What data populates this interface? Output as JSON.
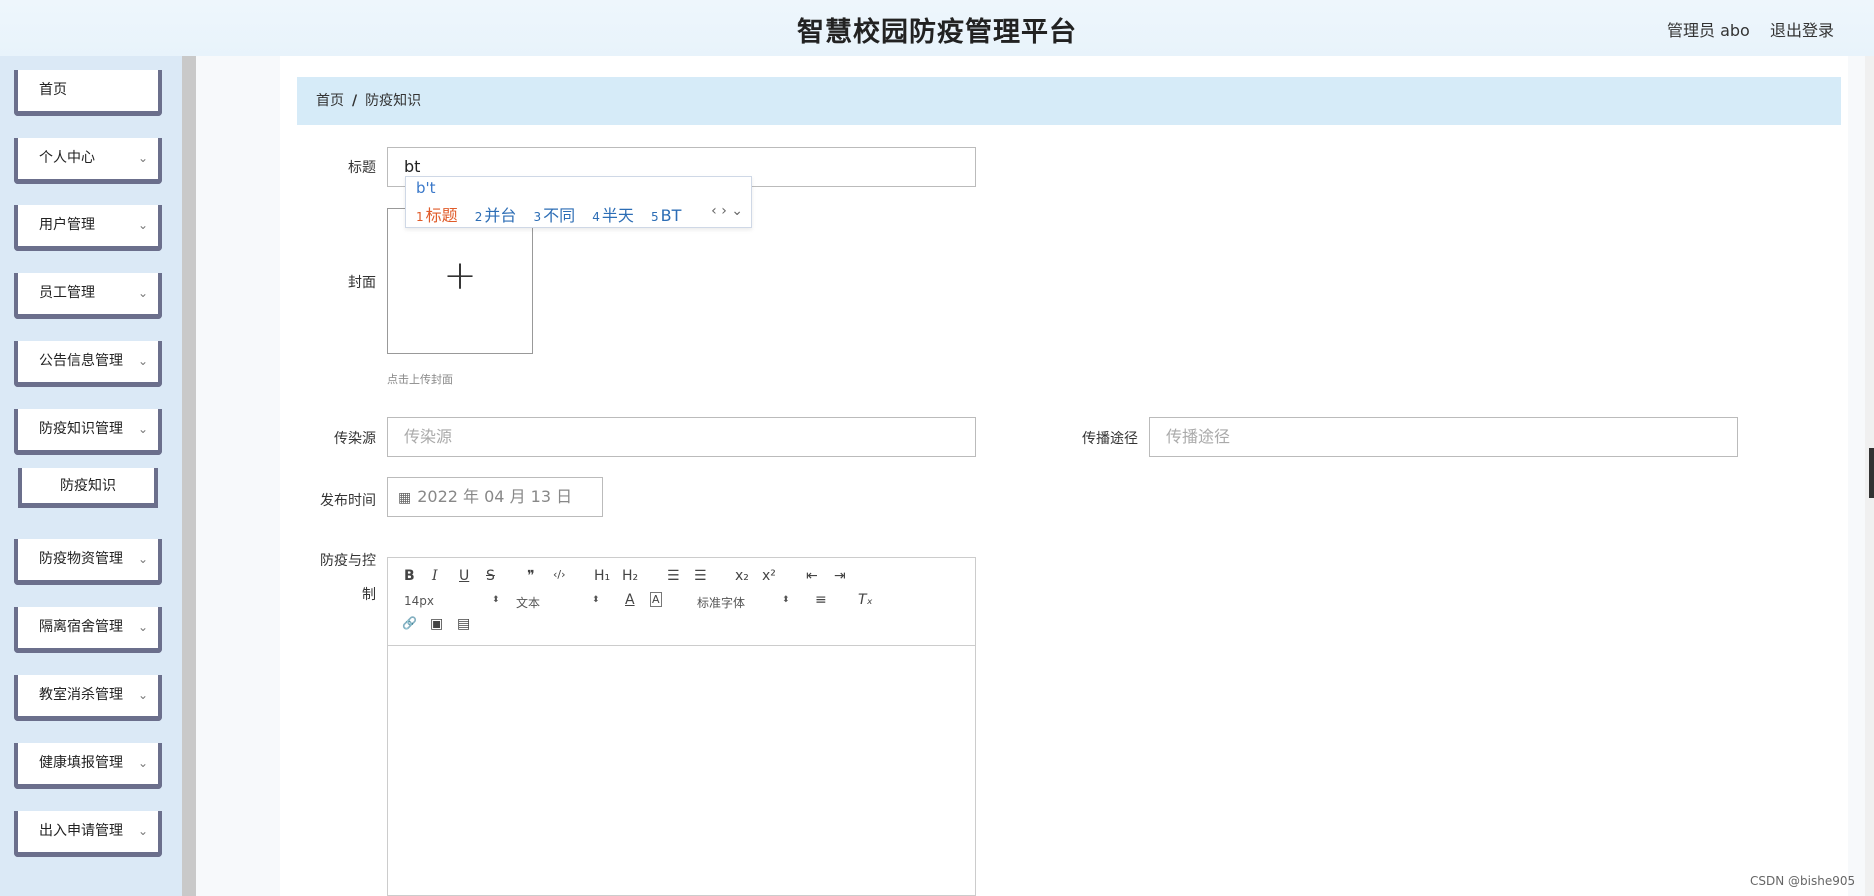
{
  "header": {
    "title": "智慧校园防疫管理平台",
    "user": "管理员 abo",
    "logout": "退出登录"
  },
  "sidebar": {
    "items": [
      {
        "label": "首页",
        "chevron": false
      },
      {
        "label": "个人中心",
        "chevron": true
      },
      {
        "label": "用户管理",
        "chevron": true
      },
      {
        "label": "员工管理",
        "chevron": true
      },
      {
        "label": "公告信息管理",
        "chevron": true
      },
      {
        "label": "防疫知识管理",
        "chevron": true
      },
      {
        "label": "防疫物资管理",
        "chevron": true
      },
      {
        "label": "隔离宿舍管理",
        "chevron": true
      },
      {
        "label": "教室消杀管理",
        "chevron": true
      },
      {
        "label": "健康填报管理",
        "chevron": true
      },
      {
        "label": "出入申请管理",
        "chevron": true
      }
    ],
    "subitem": "防疫知识",
    "chevron_glyph": "⌄"
  },
  "breadcrumb": {
    "home": "首页",
    "separator": "/",
    "current": "防疫知识"
  },
  "form": {
    "title_label": "标题",
    "title_value": "bt",
    "cover_label": "封面",
    "cover_plus": "+",
    "cover_hint": "点击上传封面",
    "source_label": "传染源",
    "source_placeholder": "传染源",
    "route_label": "传播途径",
    "route_placeholder": "传播途径",
    "date_label": "发布时间",
    "date_value": "2022 年 04 月 13 日",
    "content_label_1": "防疫与控",
    "content_label_2": "制"
  },
  "ime": {
    "composition": "b't",
    "candidates": [
      {
        "n": "1",
        "text": "标题"
      },
      {
        "n": "2",
        "text": "并台"
      },
      {
        "n": "3",
        "text": "不同"
      },
      {
        "n": "4",
        "text": "半天"
      },
      {
        "n": "5",
        "text": "BT"
      }
    ],
    "arrows": "‹ › ⌄"
  },
  "editor": {
    "buttons": {
      "bold": "B",
      "italic": "I",
      "underline": "U",
      "strike": "S",
      "quote": "❞",
      "code": "‹/›",
      "h1": "H₁",
      "h2": "H₂",
      "ol": "☰",
      "ul": "☰",
      "sub": "x₂",
      "sup": "x²",
      "outdent": "⇤",
      "indent": "⇥",
      "color": "A",
      "bg": "A",
      "align": "≡",
      "clear": "Tₓ",
      "link": "🔗",
      "image": "▣",
      "video": "▤"
    },
    "font_size": "14px",
    "header_select": "文本",
    "font_family": "标准字体",
    "select_arrow": "⬍"
  },
  "watermark": "CSDN @bishe905"
}
